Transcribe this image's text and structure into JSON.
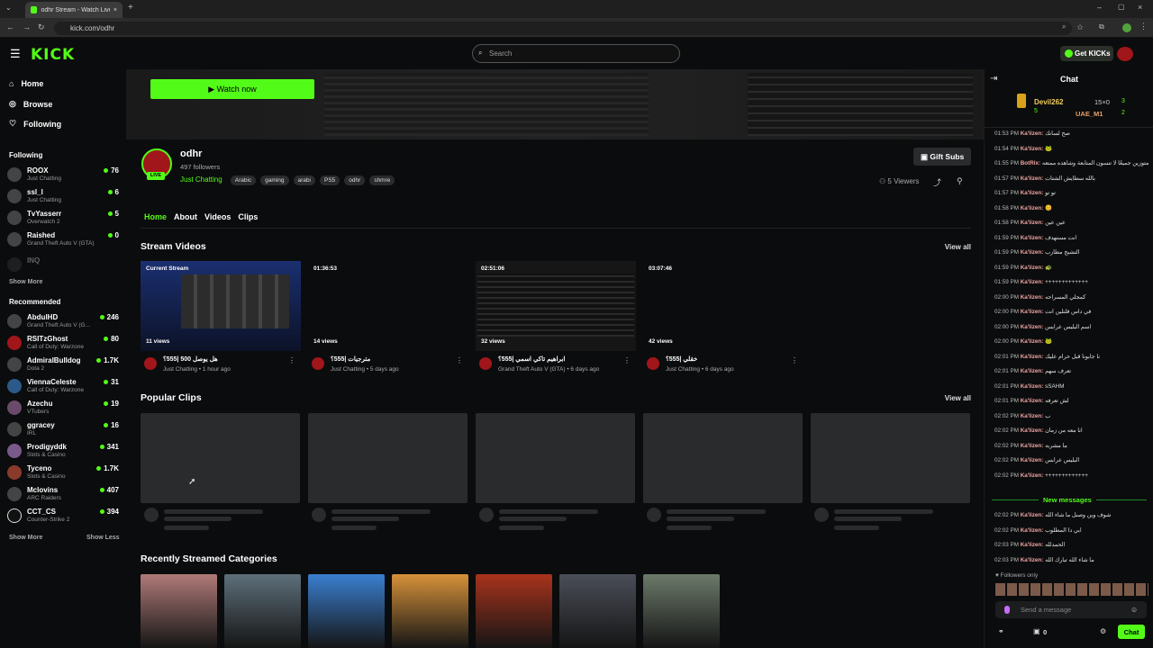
{
  "browser": {
    "tab_title": "odhr Stream - Watch Live on Ki",
    "url": "kick.com/odhr"
  },
  "nav": {
    "logo": "KICK",
    "search_placeholder": "Search",
    "get_kicks": "Get KICKs"
  },
  "sidebar": {
    "menu": [
      {
        "label": "Home",
        "icon": "home-icon"
      },
      {
        "label": "Browse",
        "icon": "compass-icon"
      },
      {
        "label": "Following",
        "icon": "heart-icon"
      }
    ],
    "following_title": "Following",
    "following": [
      {
        "name": "ROOX",
        "category": "Just Chatting",
        "viewers": "76"
      },
      {
        "name": "ssl_l",
        "category": "Just Chatting",
        "viewers": "6"
      },
      {
        "name": "TvYasserr",
        "category": "Overwatch 2",
        "viewers": "5"
      },
      {
        "name": "Raished",
        "category": "Grand Theft Auto V (GTA)",
        "viewers": "0"
      },
      {
        "name": "INQ",
        "category": "",
        "viewers": ""
      }
    ],
    "show_more_1": "Show More",
    "recommended_title": "Recommended",
    "recommended": [
      {
        "name": "AbdulHD",
        "category": "Grand Theft Auto V (G...",
        "viewers": "246"
      },
      {
        "name": "RSITzGhost",
        "category": "Call of Duty: Warzone",
        "viewers": "80"
      },
      {
        "name": "AdmiralBulldog",
        "category": "Dota 2",
        "viewers": "1.7K"
      },
      {
        "name": "ViennaCeleste",
        "category": "Call of Duty: Warzone",
        "viewers": "31"
      },
      {
        "name": "Azechu",
        "category": "VTubers",
        "viewers": "19"
      },
      {
        "name": "ggracey",
        "category": "IRL",
        "viewers": "16"
      },
      {
        "name": "Prodigyddk",
        "category": "Slots & Casino",
        "viewers": "341"
      },
      {
        "name": "Tyceno",
        "category": "Slots & Casino",
        "viewers": "1.7K"
      },
      {
        "name": "Mclovins",
        "category": "ARC Raiders",
        "viewers": "407"
      },
      {
        "name": "CCT_CS",
        "category": "Counter-Strike 2",
        "viewers": "394"
      }
    ],
    "show_more_2": "Show More",
    "show_less": "Show Less"
  },
  "channel": {
    "watch_now": "Watch now",
    "name": "odhr",
    "followers": "497 followers",
    "live": "LIVE",
    "category": "Just Chatting",
    "tags": [
      "Arabic",
      "gaming",
      "arabi",
      "PS5",
      "odhr",
      "shmre"
    ],
    "gift_subs": "Gift Subs",
    "viewers": "5 Viewers",
    "tabs": [
      "Home",
      "About",
      "Videos",
      "Clips"
    ]
  },
  "stream_videos": {
    "title": "Stream Videos",
    "view_all": "View all",
    "items": [
      {
        "duration": "Current Stream",
        "views": "11 views",
        "title": "هل يوصل 500 |555؟",
        "meta": "Just Chatting • 1 hour ago"
      },
      {
        "duration": "01:36:53",
        "views": "14 views",
        "title": "مترجيات |555؟",
        "meta": "Just Chatting • 5 days ago"
      },
      {
        "duration": "02:51:06",
        "views": "32 views",
        "title": "ابراهيم تاكي اسمي |555؟",
        "meta": "Grand Theft Auto V (GTA) • 6 days ago"
      },
      {
        "duration": "03:07:46",
        "views": "42 views",
        "title": "خقلي |555؟",
        "meta": "Just Chatting • 6 days ago"
      }
    ]
  },
  "popular_clips": {
    "title": "Popular Clips",
    "view_all": "View all"
  },
  "recent_categories": {
    "title": "Recently Streamed Categories",
    "colors": [
      "#b07a78",
      "#5d6f7a",
      "#3a7fd0",
      "#d6913a",
      "#a8331c",
      "#4a4e58",
      "#6c7a6a"
    ]
  },
  "chat": {
    "title": "Chat",
    "leaders": [
      {
        "name": "Devil262",
        "count": "5",
        "extra": "15×0",
        "score": "3"
      },
      {
        "name": "UAE_M1",
        "count": "",
        "extra": "",
        "score": "2"
      }
    ],
    "messages": [
      {
        "time": "01:53 PM",
        "user": "Ka'lizen:",
        "text": "صح لسانك"
      },
      {
        "time": "01:54 PM",
        "user": "Ka'lizen:",
        "text": "🐸"
      },
      {
        "time": "01:55 PM",
        "user": "BotRix:",
        "text": "متوزين جميعًا لا تنسون المتابعة وشاهده ممتعه 💚"
      },
      {
        "time": "01:57 PM",
        "user": "Ka'lizen:",
        "text": "بالله سطايش الشتات"
      },
      {
        "time": "01:57 PM",
        "user": "Ka'lizen:",
        "text": "تو تو"
      },
      {
        "time": "01:58 PM",
        "user": "Ka'lizen:",
        "text": "😊"
      },
      {
        "time": "01:58 PM",
        "user": "Ka'lizen:",
        "text": "عين عين"
      },
      {
        "time": "01:59 PM",
        "user": "Ka'lizen:",
        "text": "انت مستهدف"
      },
      {
        "time": "01:59 PM",
        "user": "Ka'lizen:",
        "text": "التشيج مطارب"
      },
      {
        "time": "01:59 PM",
        "user": "Ka'lizen:",
        "text": "🐢"
      },
      {
        "time": "01:59 PM",
        "user": "Ka'lizen:",
        "text": "+++++++++++++"
      },
      {
        "time": "02:00 PM",
        "user": "Ka'lizen:",
        "text": "كمجلي المسراحه"
      },
      {
        "time": "02:00 PM",
        "user": "Ka'lizen:",
        "text": "في داس قلتلين انت"
      },
      {
        "time": "02:00 PM",
        "user": "Ka'lizen:",
        "text": "اسم البليس عرابس"
      },
      {
        "time": "02:00 PM",
        "user": "Ka'lizen:",
        "text": "🐸"
      },
      {
        "time": "02:01 PM",
        "user": "Ka'lizen:",
        "text": "نا جابونا قبل حرام عليك"
      },
      {
        "time": "02:01 PM",
        "user": "Ka'lizen:",
        "text": "تعرف سهم"
      },
      {
        "time": "02:01 PM",
        "user": "Ka'lizen:",
        "text": "sSAHM"
      },
      {
        "time": "02:01 PM",
        "user": "Ka'lizen:",
        "text": "لش تعرفه"
      },
      {
        "time": "02:02 PM",
        "user": "Ka'lizen:",
        "text": "ب"
      },
      {
        "time": "02:02 PM",
        "user": "Ka'lizen:",
        "text": "انا معه من زمان"
      },
      {
        "time": "02:02 PM",
        "user": "Ka'lizen:",
        "text": "ما مشربه"
      },
      {
        "time": "02:02 PM",
        "user": "Ka'lizen:",
        "text": "البليس عرابس"
      },
      {
        "time": "02:02 PM",
        "user": "Ka'lizen:",
        "text": "+++++++++++++"
      }
    ],
    "new_messages": "New messages",
    "new": [
      {
        "time": "02:02 PM",
        "user": "Ka'lizen:",
        "text": "شوف وين وصنل ما شاء الله"
      },
      {
        "time": "02:02 PM",
        "user": "Ka'lizen:",
        "text": "ابي دا المطلوب"
      },
      {
        "time": "02:03 PM",
        "user": "Ka'lizen:",
        "text": "الحمدلله"
      },
      {
        "time": "02:03 PM",
        "user": "Ka'lizen:",
        "text": "ما شاء الله تبارك الله"
      }
    ],
    "followers_only": "Followers only",
    "send_placeholder": "Send a message",
    "points": "0",
    "chat_button": "Chat"
  }
}
